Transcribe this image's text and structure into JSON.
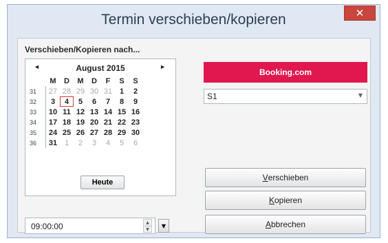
{
  "window": {
    "title": "Termin verschieben/kopieren",
    "close_label": "✕",
    "close_color": "#c9463d"
  },
  "group_label": "Verschieben/Kopieren nach...",
  "calendar": {
    "prev_label": "◄",
    "next_label": "►",
    "month_label": "August 2015",
    "day_headers": [
      "M",
      "D",
      "M",
      "D",
      "F",
      "S",
      "S"
    ],
    "weeks": [
      {
        "week": "31",
        "days": [
          "27",
          "28",
          "29",
          "30",
          "31",
          "1",
          "2"
        ]
      },
      {
        "week": "32",
        "days": [
          "3",
          "4",
          "5",
          "6",
          "7",
          "8",
          "9"
        ]
      },
      {
        "week": "33",
        "days": [
          "10",
          "11",
          "12",
          "13",
          "14",
          "15",
          "16"
        ]
      },
      {
        "week": "34",
        "days": [
          "17",
          "18",
          "19",
          "20",
          "21",
          "22",
          "23"
        ]
      },
      {
        "week": "35",
        "days": [
          "24",
          "25",
          "26",
          "27",
          "28",
          "29",
          "30"
        ]
      },
      {
        "week": "36",
        "days": [
          "31",
          "1",
          "2",
          "3",
          "4",
          "5",
          "6"
        ]
      }
    ],
    "selected_day": "4",
    "today_button": "Heute"
  },
  "time": {
    "value": "09:00:00",
    "spin_up": "▲",
    "spin_down": "▼",
    "dropdown_arrow": "▼"
  },
  "brand": {
    "label": "Booking.com",
    "color": "#e0184f"
  },
  "select": {
    "value": "S1",
    "arrow": "▼"
  },
  "buttons": {
    "move": {
      "first": "V",
      "rest": "erschieben"
    },
    "copy": {
      "first": "K",
      "rest": "opieren"
    },
    "cancel": {
      "first": "A",
      "rest": "bbrechen"
    }
  }
}
